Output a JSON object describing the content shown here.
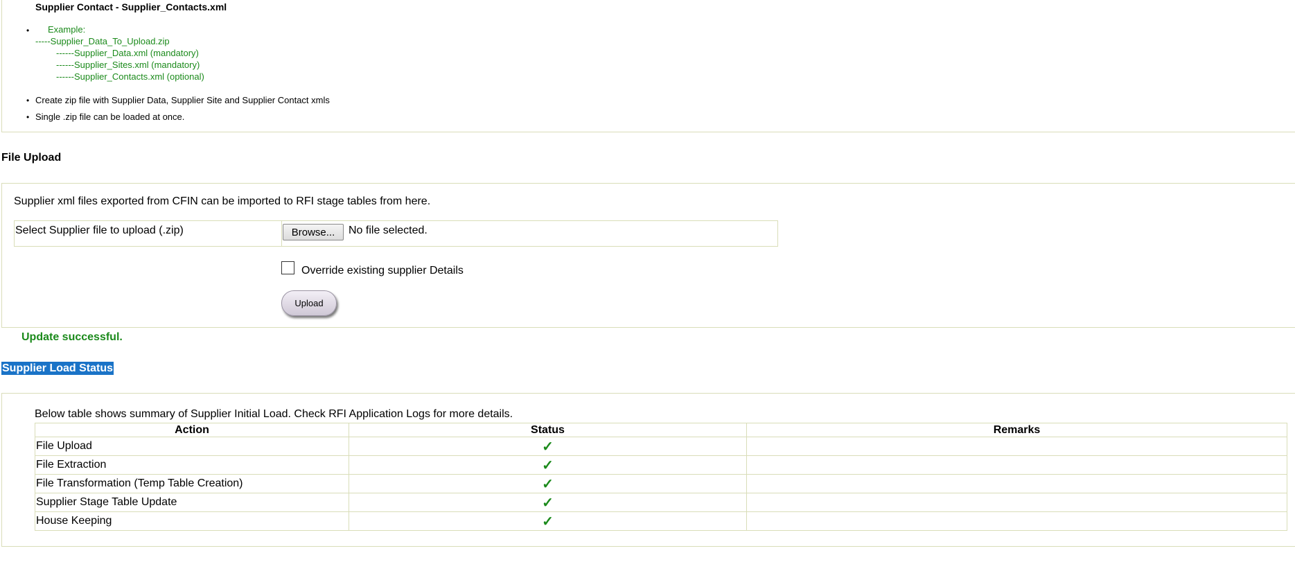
{
  "instructions": {
    "title": "Supplier Contact - Supplier_Contacts.xml",
    "example_label": "Example:",
    "zip_name": "-----Supplier_Data_To_Upload.zip",
    "zip_items": [
      "------Supplier_Data.xml (mandatory)",
      "------Supplier_Sites.xml (mandatory)",
      "------Supplier_Contacts.xml (optional)"
    ],
    "bullets": [
      "Create zip file with Supplier Data, Supplier Site and Supplier Contact xmls",
      "Single .zip file can be loaded at once."
    ]
  },
  "file_upload": {
    "heading": "File Upload",
    "description": "Supplier xml files exported from CFIN can be imported to RFI stage tables from here.",
    "select_label": "Select Supplier file to upload (.zip)",
    "browse_label": "Browse...",
    "file_status": "No file selected.",
    "override_label": "Override existing supplier Details",
    "upload_label": "Upload"
  },
  "message": "Update successful.",
  "status": {
    "heading": "Supplier Load Status",
    "description": "Below table shows summary of Supplier Initial Load. Check RFI Application Logs for more details.",
    "columns": [
      "Action",
      "Status",
      "Remarks"
    ],
    "rows": [
      {
        "action": "File Upload",
        "status": "✓",
        "remarks": ""
      },
      {
        "action": "File Extraction",
        "status": "✓",
        "remarks": ""
      },
      {
        "action": "File Transformation (Temp Table Creation)",
        "status": "✓",
        "remarks": ""
      },
      {
        "action": "Supplier Stage Table Update",
        "status": "✓",
        "remarks": ""
      },
      {
        "action": "House Keeping",
        "status": "✓",
        "remarks": ""
      }
    ]
  },
  "colors": {
    "success_green": "#1b8a1b",
    "border": "#d9ddb8",
    "highlight": "#1a73c7"
  }
}
